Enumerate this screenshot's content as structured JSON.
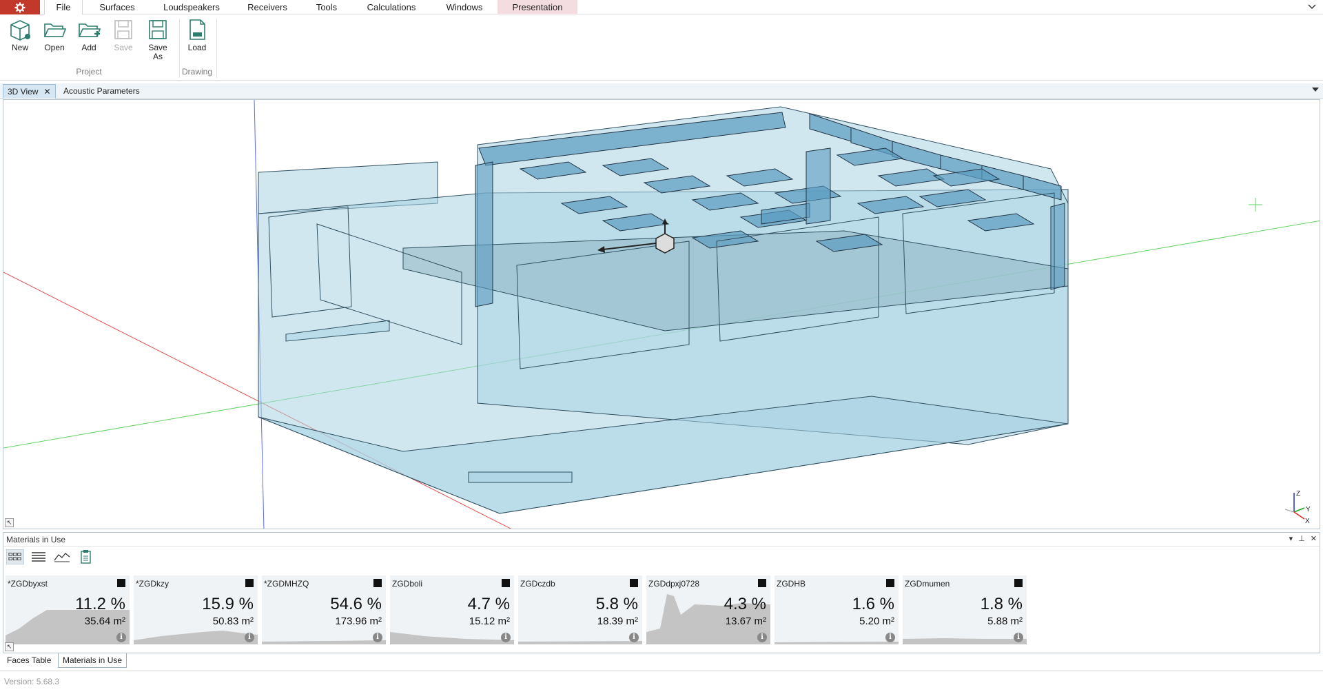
{
  "menu": {
    "tabs": [
      {
        "label": "File",
        "active": true
      },
      {
        "label": "Surfaces"
      },
      {
        "label": "Loudspeakers"
      },
      {
        "label": "Receivers"
      },
      {
        "label": "Tools"
      },
      {
        "label": "Calculations"
      },
      {
        "label": "Windows"
      },
      {
        "label": "Presentation",
        "highlight": true
      }
    ]
  },
  "ribbon": {
    "project": {
      "group_label": "Project",
      "buttons": [
        {
          "label": "New",
          "icon": "new-cube-icon"
        },
        {
          "label": "Open",
          "icon": "folder-open-icon"
        },
        {
          "label": "Add",
          "icon": "folder-add-icon"
        },
        {
          "label": "Save",
          "icon": "save-disk-icon",
          "disabled": true
        },
        {
          "label": "Save As",
          "icon": "save-as-disk-icon"
        }
      ]
    },
    "drawing": {
      "group_label": "Drawing",
      "buttons": [
        {
          "label": "Load",
          "icon": "load-drawing-icon"
        }
      ]
    }
  },
  "doc_tabs": [
    {
      "label": "3D View",
      "active": true,
      "closable": true
    },
    {
      "label": "Acoustic Parameters"
    }
  ],
  "viewport": {
    "axis_gizmo": {
      "z": "Z",
      "y": "Y",
      "x": "X"
    }
  },
  "materials_panel": {
    "title": "Materials in Use",
    "materials": [
      {
        "name": "*ZGDbyxst",
        "percent": "11.2 %",
        "area": "35.64 m²"
      },
      {
        "name": "*ZGDkzy",
        "percent": "15.9 %",
        "area": "50.83 m²"
      },
      {
        "name": "*ZGDMHZQ",
        "percent": "54.6 %",
        "area": "173.96 m²"
      },
      {
        "name": "ZGDboli",
        "percent": "4.7 %",
        "area": "15.12 m²"
      },
      {
        "name": "ZGDczdb",
        "percent": "5.8 %",
        "area": "18.39 m²"
      },
      {
        "name": "ZGDdpxj0728",
        "percent": "4.3 %",
        "area": "13.67 m²"
      },
      {
        "name": "ZGDHB",
        "percent": "1.6 %",
        "area": "5.20 m²"
      },
      {
        "name": "ZGDmumen",
        "percent": "1.8 %",
        "area": "5.88 m²"
      }
    ]
  },
  "bottom_tabs": [
    {
      "label": "Faces Table"
    },
    {
      "label": "Materials in Use",
      "active": true
    }
  ],
  "status": {
    "version": "Version: 5.68.3"
  },
  "colors": {
    "accent": "#c2392b",
    "room_fill": "#a9d3e3",
    "panel_fill": "#5a9bbf"
  }
}
